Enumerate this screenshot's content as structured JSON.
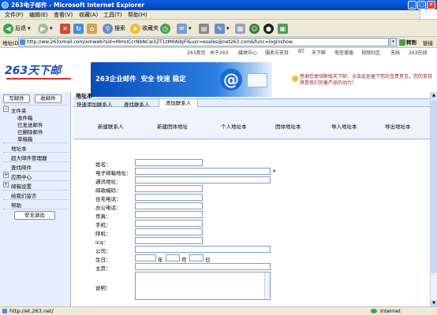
{
  "window": {
    "title": "263电子邮件 - Microsoft Internet Explorer",
    "min": "_",
    "max": "□",
    "close": "✕"
  },
  "menu": [
    "文件(F)",
    "编辑(E)",
    "查看(V)",
    "收藏(A)",
    "工具(T)",
    "帮助(H)"
  ],
  "toolbar": {
    "back": "后退",
    "search": "搜索",
    "favorites": "收藏夹"
  },
  "address": {
    "label": "地址(D)",
    "url": "http://ww.263xmail.com/xmweb?sid=MmUCcrNbNCw3ZT1zM0AibjFl&usr=esales@net263.com&func=loginshow",
    "go": "转到",
    "links": "链接"
  },
  "topnav": [
    "263首页",
    "关于263",
    "媒体中心",
    "服务与支持",
    "BT",
    "天下邮",
    "电信增值",
    "视频社区",
    "无线",
    "263在线"
  ],
  "banner": {
    "logo": "263天下邮",
    "slogan": "263企业邮件  安全 快速 稳定",
    "notice": "感谢您体验新版天下邮，点击此处留下您的宝贵意见，您的支持将是我们完善产品的动力！"
  },
  "sidebar": {
    "write": "写邮件",
    "receive": "收邮件",
    "folders": "文件夹",
    "inbox": "收件箱",
    "sent": "已发送邮件",
    "deleted": "已删除邮件",
    "drafts": "草稿箱",
    "addressbook": "地址本",
    "attachments": "超大邮件管理器",
    "findmail": "查找邮件",
    "apps": "应用中心",
    "settings": "邮箱设置",
    "feedback": "给我们留言",
    "help": "帮助",
    "logout": "安全退出"
  },
  "main": {
    "heading": "地址本",
    "tabs": [
      "快速添加联系人",
      "查找联系人",
      "添加联系人"
    ],
    "actions": [
      "新建联系人",
      "新建团体地址",
      "个人地址本",
      "团体地址本",
      "导入地址本",
      "导出地址本"
    ],
    "fields": [
      "姓名：",
      "电子邮箱地址：",
      "通讯地址：",
      "邮政编码：",
      "住宅电话：",
      "办公电话：",
      "传真：",
      "手机：",
      "呼机：",
      "icq：",
      "公司：",
      "生日：",
      "主页：",
      "说明："
    ],
    "birthday": {
      "year": "年",
      "month": "月",
      "day": "日"
    },
    "required": "*"
  },
  "status": {
    "url": "http://et.263.net/",
    "zone": "Internet"
  }
}
